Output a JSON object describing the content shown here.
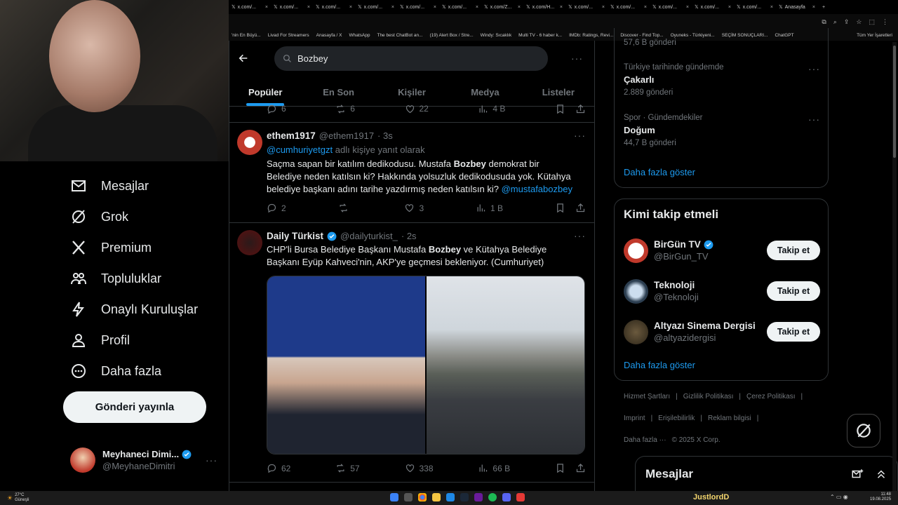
{
  "browser": {
    "tabs": [
      {
        "label": "x.com/..."
      },
      {
        "label": "x.com/..."
      },
      {
        "label": "x.com/..."
      },
      {
        "label": "x.com/..."
      },
      {
        "label": "x.com/..."
      },
      {
        "label": "x.com/..."
      },
      {
        "label": "x.com/Z..."
      },
      {
        "label": "x.com/H..."
      },
      {
        "label": "x.com/..."
      },
      {
        "label": "x.com/..."
      },
      {
        "label": "x.com/..."
      },
      {
        "label": "x.com/..."
      },
      {
        "label": "x.com/..."
      },
      {
        "label": "Anasayfa"
      }
    ],
    "bookmarks": [
      "'nin En Büyü...",
      "Livad For Streamers",
      "Anasayfa / X",
      "WhatsApp",
      "The best ChatBot an...",
      "(19) Alert Box / Stre...",
      "Windy: Sıcaklık",
      "Multi TV - 6 haber k...",
      "IMDb: Ratings, Revi...",
      "Discover - Find Top...",
      "Oyuneks - Türkiyeni...",
      "SEÇİM SONUÇLARI...",
      "ChatGPT",
      "Tüm Yer İşaretleri"
    ]
  },
  "nav": {
    "items": [
      {
        "label": "Mesajlar",
        "icon": "mail-icon"
      },
      {
        "label": "Grok",
        "icon": "grok-icon"
      },
      {
        "label": "Premium",
        "icon": "x-logo-icon"
      },
      {
        "label": "Topluluklar",
        "icon": "communities-icon"
      },
      {
        "label": "Onaylı Kuruluşlar",
        "icon": "lightning-icon"
      },
      {
        "label": "Profil",
        "icon": "person-icon"
      },
      {
        "label": "Daha fazla",
        "icon": "more-circle-icon"
      }
    ],
    "post_button": "Gönderi yayınla",
    "account": {
      "name": "Meyhaneci Dimi...",
      "handle": "@MeyhaneDimitri"
    }
  },
  "search": {
    "value": "Bozbey"
  },
  "tabs": [
    "Popüler",
    "En Son",
    "Kişiler",
    "Medya",
    "Listeler"
  ],
  "prev_tweet_actions": {
    "replies": "6",
    "reposts": "6",
    "likes": "22",
    "views": "4 B"
  },
  "tweets": [
    {
      "name": "ethem1917",
      "handle": "@ethem1917",
      "time": "· 3s",
      "reply_to_handle": "@cumhuriyetgzt",
      "reply_to_suffix": "adlı kişiye yanıt olarak",
      "text_1": "Saçma sapan bir katılım dedikodusu. Mustafa ",
      "text_bold": "Bozbey",
      "text_2": " demokrat bir",
      "line2": "Belediye  neden katılsın ki? Hakkında yolsuzluk dedikodusuda yok. Kütahya",
      "line3": "belediye başkanı adını tarihe yazdırmış neden katılsın ki? ",
      "mention": "@mustafabozbey",
      "replies": "2",
      "reposts": "",
      "likes": "3",
      "views": "1 B"
    },
    {
      "name": "Daily Türkist",
      "handle": "@dailyturkist_",
      "time": "· 2s",
      "line1_a": "CHP'li Bursa Belediye Başkanı Mustafa ",
      "line1_bold": "Bozbey",
      "line1_b": " ve Kütahya Belediye",
      "line2": "Başkanı Eyüp Kahveci'nin, AKP'ye geçmesi bekleniyor. (Cumhuriyet)",
      "replies": "62",
      "reposts": "57",
      "likes": "338",
      "views": "66 B"
    }
  ],
  "trends": [
    {
      "sub": "",
      "title": "",
      "count": "57,6 B gönderi"
    },
    {
      "sub": "Türkiye tarihinde gündemde",
      "title": "Çakarlı",
      "count": "2.889 gönderi"
    },
    {
      "sub": "Spor · Gündemdekiler",
      "title": "Doğum",
      "count": "44,7 B gönderi"
    }
  ],
  "trends_more": "Daha fazla göster",
  "who_to_follow": {
    "title": "Kimi takip etmeli",
    "accounts": [
      {
        "name": "BirGün TV",
        "handle": "@BirGun_TV",
        "button": "Takip et"
      },
      {
        "name": "Teknoloji",
        "handle": "@Teknoloji",
        "button": "Takip et"
      },
      {
        "name": "Altyazı Sinema Dergisi",
        "handle": "@altyazidergisi",
        "button": "Takip et"
      }
    ],
    "more": "Daha fazla göster"
  },
  "footer": {
    "links": [
      "Hizmet Şartları",
      "Gizlilik Politikası",
      "Çerez Politikası",
      "Imprint",
      "Erişilebilirlik",
      "Reklam bilgisi",
      "Daha fazla ···"
    ],
    "copyright": "© 2025 X Corp."
  },
  "messages_dock": "Mesajlar",
  "taskbar": {
    "weather_temp": "27°C",
    "weather_desc": "Güneşli",
    "user_label": "JustlordD",
    "time": "11:48",
    "date": "19.08.2025"
  }
}
